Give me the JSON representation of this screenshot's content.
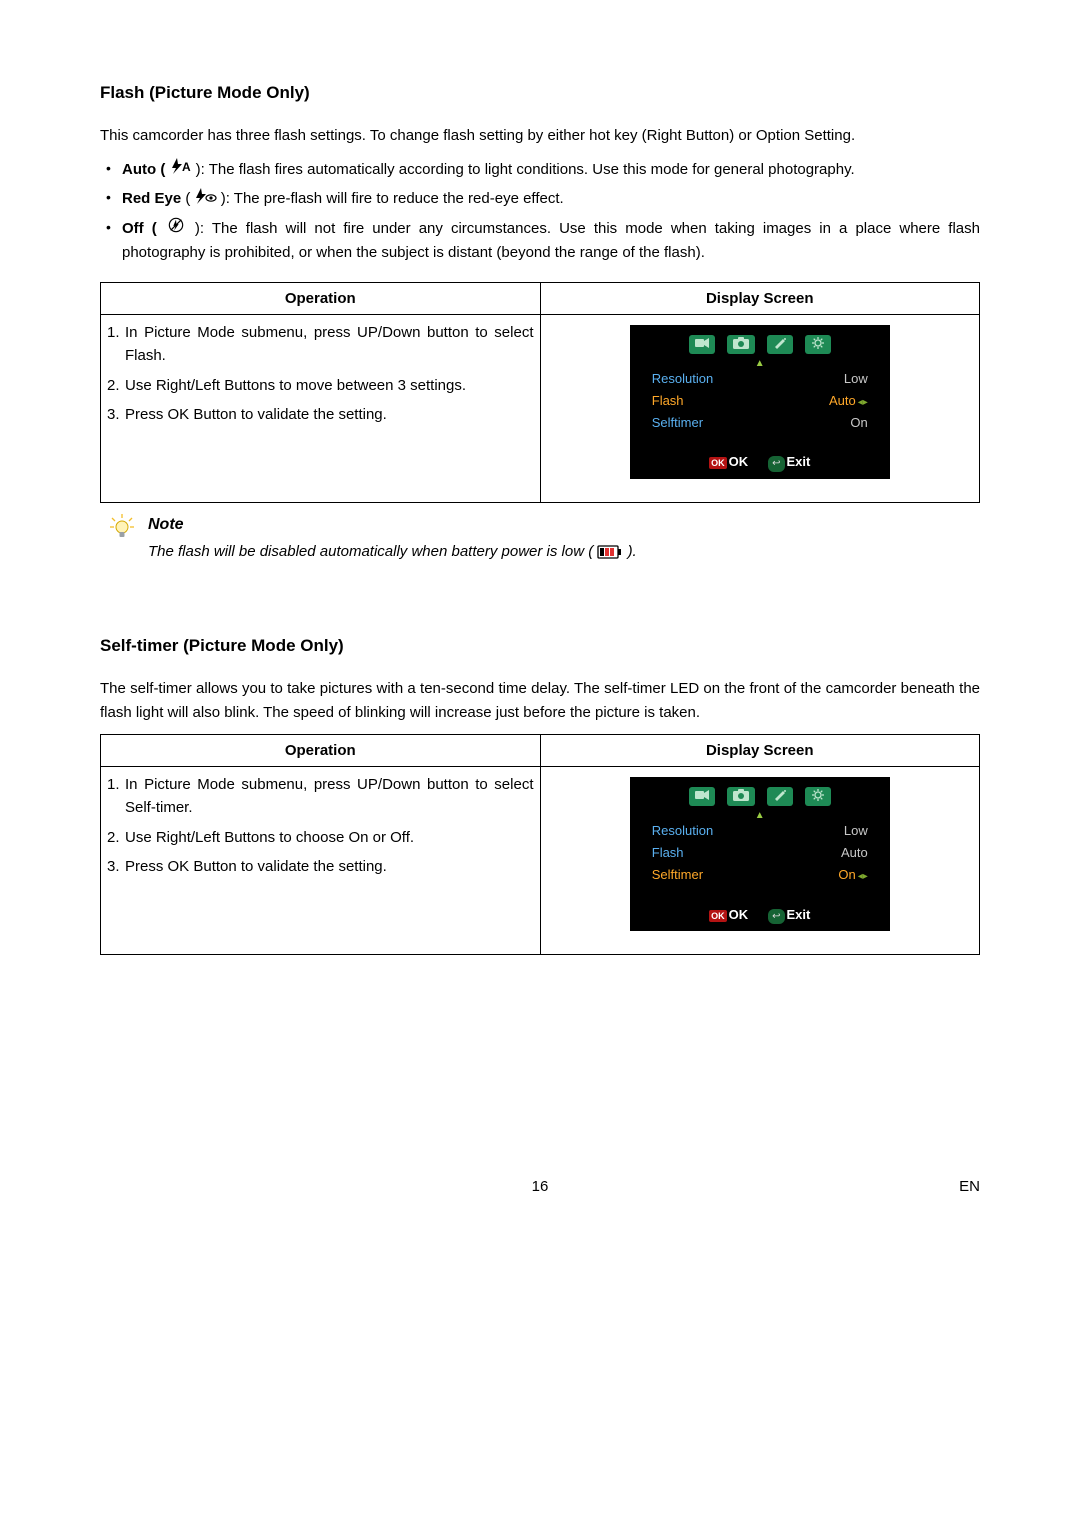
{
  "flash": {
    "heading": "Flash (Picture Mode Only)",
    "intro": "This camcorder has three flash settings. To change flash setting by either hot key (Right Button) or Option Setting.",
    "modes": {
      "auto_label": "Auto (",
      "auto_text": "): The flash fires automatically according to light conditions. Use this mode for general photography.",
      "redeye_label": "Red Eye",
      "redeye_text": "): The pre-flash will fire to reduce the red-eye effect.",
      "off_label": "Off (",
      "off_text": "): The flash will not fire under any circumstances. Use this mode when taking images in a place where flash photography is prohibited, or when the subject is distant (beyond the range of the flash)."
    },
    "table": {
      "col_operation": "Operation",
      "col_display": "Display Screen",
      "step1": "In Picture Mode submenu, press UP/Down button to select Flash.",
      "step2": "Use Right/Left Buttons to move between 3 settings.",
      "step3": "Press OK Button to validate the setting."
    },
    "display": {
      "row1_label": "Resolution",
      "row1_value": "Low",
      "row2_label": "Flash",
      "row2_value": "Auto",
      "row3_label": "Selftimer",
      "row3_value": "On",
      "ok": "OK",
      "exit": "Exit"
    },
    "note": {
      "title": "Note",
      "text_before": "The flash will be disabled automatically when battery power is low (",
      "text_after": ")."
    }
  },
  "selftimer": {
    "heading": "Self-timer (Picture Mode Only)",
    "intro": "The self-timer allows you to take pictures with a ten-second time delay. The self-timer LED on the front of the camcorder beneath the flash light will also blink. The speed of blinking will increase just before the picture is taken.",
    "table": {
      "col_operation": "Operation",
      "col_display": "Display Screen",
      "step1": "In Picture Mode submenu, press UP/Down button to select Self-timer.",
      "step2": "Use Right/Left Buttons to choose On or Off.",
      "step3": "Press OK Button to validate the setting."
    },
    "display": {
      "row1_label": "Resolution",
      "row1_value": "Low",
      "row2_label": "Flash",
      "row2_value": "Auto",
      "row3_label": "Selftimer",
      "row3_value": "On",
      "ok": "OK",
      "exit": "Exit"
    }
  },
  "footer": {
    "page": "16",
    "lang": "EN"
  }
}
